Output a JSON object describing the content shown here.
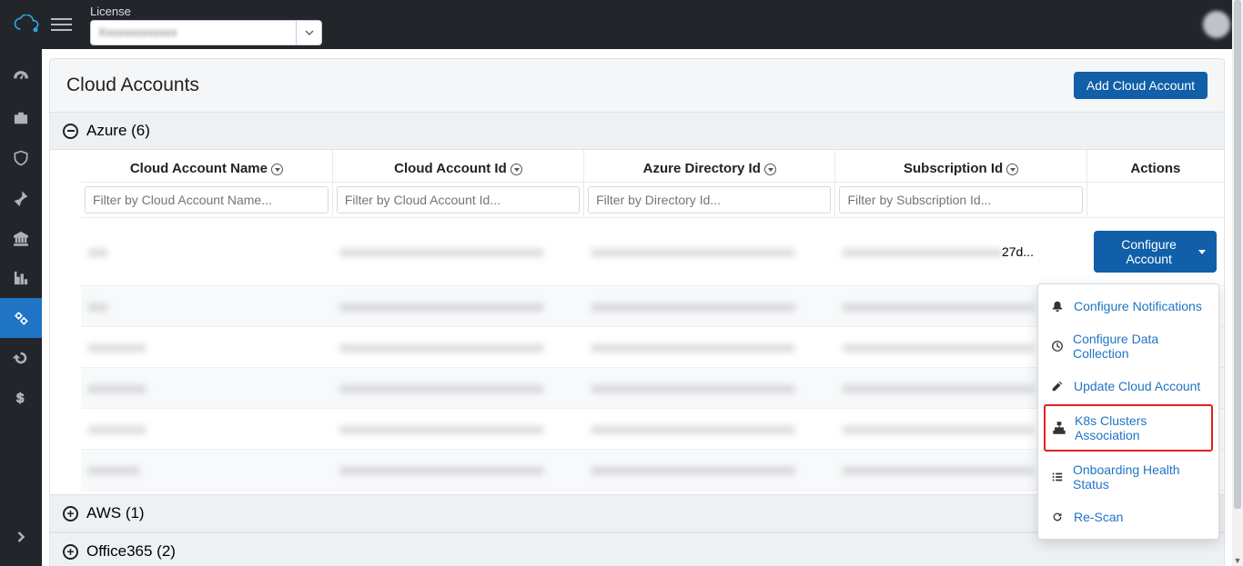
{
  "header": {
    "license_label": "License",
    "license_value": "Xxxxxxxxxxxxx"
  },
  "sidenav": {
    "items": [
      {
        "name": "dashboard-icon"
      },
      {
        "name": "briefcase-icon"
      },
      {
        "name": "shield-icon"
      },
      {
        "name": "pin-icon"
      },
      {
        "name": "bank-icon"
      },
      {
        "name": "chart-icon"
      },
      {
        "name": "gears-icon",
        "active": true
      },
      {
        "name": "history-icon"
      },
      {
        "name": "dollar-icon"
      }
    ]
  },
  "page": {
    "title": "Cloud Accounts",
    "add_button": "Add Cloud Account"
  },
  "groups": [
    {
      "label": "Azure (6)",
      "expanded": true
    },
    {
      "label": "AWS (1)",
      "expanded": false
    },
    {
      "label": "Office365 (2)",
      "expanded": false
    }
  ],
  "table": {
    "headers": [
      "Cloud Account Name",
      "Cloud Account Id",
      "Azure Directory Id",
      "Subscription Id",
      "Actions"
    ],
    "filters": {
      "name": "Filter by Cloud Account Name...",
      "id": "Filter by Cloud Account Id...",
      "dir": "Filter by Directory Id...",
      "sub": "Filter by Subscription Id..."
    },
    "rows": [
      {
        "name": "xxx",
        "id": "xxxxxxxxxxxxxxxxxxxxxxxxxxxxxxxx",
        "dir": "xxxxxxxxxxxxxxxxxxxxxxxxxxxxxxxx",
        "sub": "xxxxxxxxxxxxxxxxxxxxxxxxx27d...",
        "action": "Configure Account"
      },
      {
        "name": "xxx",
        "id": "xxxxxxxxxxxxxxxxxxxxxxxxxxxxxxxx",
        "dir": "xxxxxxxxxxxxxxxxxxxxxxxxxxxxxxxx",
        "sub": "xxxxxxxxxxxxxxxxxxxxxxxxxxxxxx"
      },
      {
        "name": "xxxxxxxxx",
        "id": "xxxxxxxxxxxxxxxxxxxxxxxxxxxxxxxx",
        "dir": "xxxxxxxxxxxxxxxxxxxxxxxxxxxxxxxx",
        "sub": "xxxxxxxxxxxxxxxxxxxxxxxxxxxxxx"
      },
      {
        "name": "xxxxxxxxx",
        "id": "xxxxxxxxxxxxxxxxxxxxxxxxxxxxxxxx",
        "dir": "xxxxxxxxxxxxxxxxxxxxxxxxxxxxxxxx",
        "sub": "xxxxxxxxxxxxxxxxxxxxxxxxxxxxxx"
      },
      {
        "name": "xxxxxxxxx",
        "id": "xxxxxxxxxxxxxxxxxxxxxxxxxxxxxxxx",
        "dir": "xxxxxxxxxxxxxxxxxxxxxxxxxxxxxxxx",
        "sub": "xxxxxxxxxxxxxxxxxxxxxxxxxxxxxx"
      },
      {
        "name": "xxxxxxxx",
        "id": "xxxxxxxxxxxxxxxxxxxxxxxxxxxxxxxx",
        "dir": "xxxxxxxxxxxxxxxxxxxxxxxxxxxxxxxx",
        "sub": "xxxxxxxxxxxxxxxxxxxxxxxxxxxxxx"
      }
    ]
  },
  "dropdown": {
    "items": [
      {
        "label": "Configure Notifications",
        "icon": "bell-icon"
      },
      {
        "label": "Configure Data Collection",
        "icon": "clock-icon"
      },
      {
        "label": "Update Cloud Account",
        "icon": "edit-icon"
      },
      {
        "label": "K8s Clusters Association",
        "icon": "sitemap-icon",
        "highlight": true
      },
      {
        "label": "Onboarding Health Status",
        "icon": "list-icon"
      },
      {
        "label": "Re-Scan",
        "icon": "refresh-icon"
      }
    ]
  }
}
